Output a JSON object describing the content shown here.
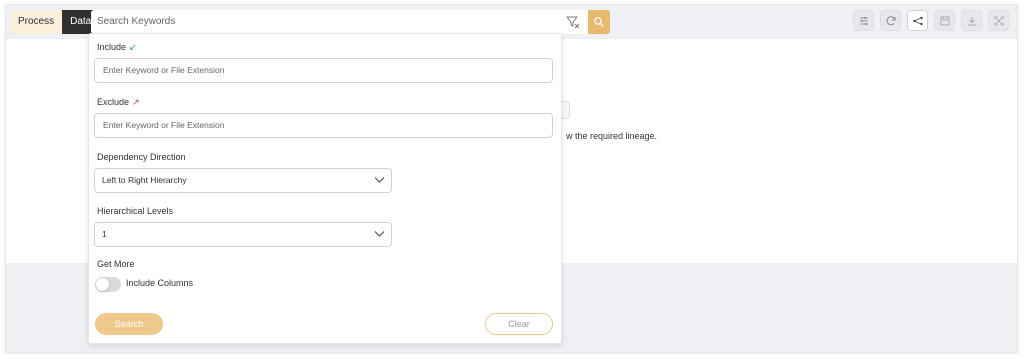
{
  "toolbar": {
    "mode_process": "Process",
    "mode_data": "Data",
    "search_placeholder": "Search Keywords",
    "tools": [
      "settings-icon",
      "refresh-icon",
      "lineage-icon",
      "save-icon",
      "download-icon",
      "fullscreen-icon"
    ]
  },
  "canvas": {
    "message_partial": "w the required lineage."
  },
  "filter_panel": {
    "include_label": "Include",
    "include_placeholder": "Enter Keyword or File Extension",
    "exclude_label": "Exclude",
    "exclude_placeholder": "Enter Keyword or File Extension",
    "direction_label": "Dependency Direction",
    "direction_value": "Left to Right Hierarchy",
    "levels_label": "Hierarchical Levels",
    "levels_value": "1",
    "get_more_label": "Get More",
    "include_columns_label": "Include Columns",
    "include_columns_on": false,
    "search_label": "Search",
    "clear_label": "Clear"
  },
  "colors": {
    "accent": "#e8b86d",
    "accent_light": "#efc88b",
    "dark": "#2f2f2f",
    "include_arrow": "#2e9e3d",
    "exclude_arrow": "#d8343c"
  }
}
